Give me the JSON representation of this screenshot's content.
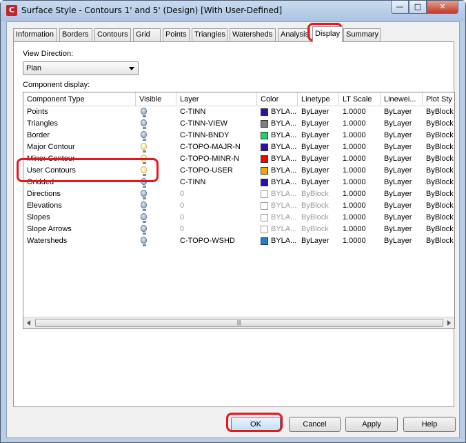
{
  "window": {
    "title": "Surface Style - Contours 1' and 5' (Design) [With User-Defined]",
    "icon": "autocad-civil-icon",
    "controls": [
      "minimize",
      "maximize",
      "close"
    ]
  },
  "tabs": [
    {
      "label": "Information"
    },
    {
      "label": "Borders"
    },
    {
      "label": "Contours"
    },
    {
      "label": "Grid"
    },
    {
      "label": "Points"
    },
    {
      "label": "Triangles"
    },
    {
      "label": "Watersheds"
    },
    {
      "label": "Analysis"
    },
    {
      "label": "Display"
    },
    {
      "label": "Summary"
    }
  ],
  "active_tab": "Display",
  "display": {
    "view_direction_label": "View Direction:",
    "view_direction_value": "Plan",
    "component_display_label": "Component display:",
    "columns": [
      "Component Type",
      "Visible",
      "Layer",
      "Color",
      "Linetype",
      "LT Scale",
      "Linewei...",
      "Plot Sty"
    ],
    "rows": [
      {
        "component": "Points",
        "visible": "off",
        "layer": "C-TINN",
        "color_hex": "#2b0fb5",
        "color_text": "BYLA...",
        "linetype": "ByLayer",
        "lt_scale": "1.0000",
        "lineweight": "ByLayer",
        "plot_style": "ByBlock",
        "greyed": false
      },
      {
        "component": "Triangles",
        "visible": "off",
        "layer": "C-TINN-VIEW",
        "color_hex": "#7f7f7f",
        "color_text": "BYLA...",
        "linetype": "ByLayer",
        "lt_scale": "1.0000",
        "lineweight": "ByLayer",
        "plot_style": "ByBlock",
        "greyed": false
      },
      {
        "component": "Border",
        "visible": "off",
        "layer": "C-TINN-BNDY",
        "color_hex": "#1fd36c",
        "color_text": "BYLA...",
        "linetype": "ByLayer",
        "lt_scale": "1.0000",
        "lineweight": "ByLayer",
        "plot_style": "ByBlock",
        "greyed": false
      },
      {
        "component": "Major Contour",
        "visible": "on",
        "layer": "C-TOPO-MAJR-N",
        "color_hex": "#2b0fb5",
        "color_text": "BYLA...",
        "linetype": "ByLayer",
        "lt_scale": "1.0000",
        "lineweight": "ByLayer",
        "plot_style": "ByBlock",
        "greyed": false
      },
      {
        "component": "Minor Contour",
        "visible": "on",
        "layer": "C-TOPO-MINR-N",
        "color_hex": "#ff0000",
        "color_text": "BYLA...",
        "linetype": "ByLayer",
        "lt_scale": "1.0000",
        "lineweight": "ByLayer",
        "plot_style": "ByBlock",
        "greyed": false
      },
      {
        "component": "User Contours",
        "visible": "on",
        "layer": "C-TOPO-USER",
        "color_hex": "#ffa500",
        "color_text": "BYLA...",
        "linetype": "ByLayer",
        "lt_scale": "1.0000",
        "lineweight": "ByLayer",
        "plot_style": "ByBlock",
        "greyed": false
      },
      {
        "component": "Gridded",
        "visible": "off",
        "layer": "C-TINN",
        "color_hex": "#2b0fb5",
        "color_text": "BYLA...",
        "linetype": "ByLayer",
        "lt_scale": "1.0000",
        "lineweight": "ByLayer",
        "plot_style": "ByBlock",
        "greyed": false
      },
      {
        "component": "Directions",
        "visible": "off",
        "layer": "0",
        "color_hex": "",
        "color_text": "BYLA...",
        "linetype": "ByBlock",
        "lt_scale": "1.0000",
        "lineweight": "ByLayer",
        "plot_style": "ByBlock",
        "greyed": true
      },
      {
        "component": "Elevations",
        "visible": "off",
        "layer": "0",
        "color_hex": "",
        "color_text": "BYLA...",
        "linetype": "ByBlock",
        "lt_scale": "1.0000",
        "lineweight": "ByLayer",
        "plot_style": "ByBlock",
        "greyed": true
      },
      {
        "component": "Slopes",
        "visible": "off",
        "layer": "0",
        "color_hex": "",
        "color_text": "BYLA...",
        "linetype": "ByBlock",
        "lt_scale": "1.0000",
        "lineweight": "ByLayer",
        "plot_style": "ByBlock",
        "greyed": true
      },
      {
        "component": "Slope Arrows",
        "visible": "off",
        "layer": "0",
        "color_hex": "",
        "color_text": "BYLA...",
        "linetype": "ByBlock",
        "lt_scale": "1.0000",
        "lineweight": "ByLayer",
        "plot_style": "ByBlock",
        "greyed": true
      },
      {
        "component": "Watersheds",
        "visible": "off",
        "layer": "C-TOPO-WSHD",
        "color_hex": "#1e7fe0",
        "color_text": "BYLA...",
        "linetype": "ByLayer",
        "lt_scale": "1.0000",
        "lineweight": "ByLayer",
        "plot_style": "ByBlock",
        "greyed": false
      }
    ]
  },
  "buttons": {
    "ok": "OK",
    "cancel": "Cancel",
    "apply": "Apply",
    "help": "Help"
  },
  "colors": {
    "annotation_red": "#e8151b",
    "window_frame": "#b9cde4",
    "dialog_bg": "#f0f0f0"
  }
}
